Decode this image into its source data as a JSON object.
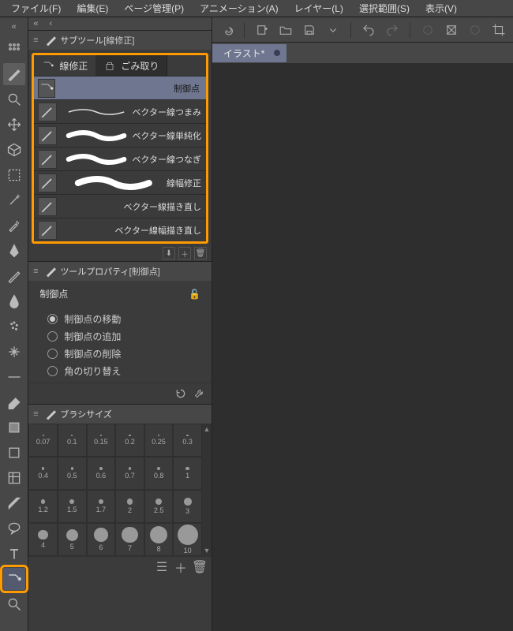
{
  "menu": [
    "ファイル(F)",
    "編集(E)",
    "ページ管理(P)",
    "アニメーション(A)",
    "レイヤー(L)",
    "選択範囲(S)",
    "表示(V)"
  ],
  "doc_tab": "イラスト*",
  "subtool_panel": {
    "title": "サブツール",
    "title_sub": "[線修正]",
    "tabs": [
      {
        "label": "線修正",
        "active": true
      },
      {
        "label": "ごみ取り",
        "active": false
      }
    ],
    "items": [
      {
        "label": "制御点",
        "selected": true,
        "stroke": "none"
      },
      {
        "label": "ベクター線つまみ",
        "stroke": "thin"
      },
      {
        "label": "ベクター線単純化",
        "stroke": "thick"
      },
      {
        "label": "ベクター線つなぎ",
        "stroke": "thick"
      },
      {
        "label": "線幅修正",
        "stroke": "thick"
      },
      {
        "label": "ベクター線描き直し",
        "stroke": "none"
      },
      {
        "label": "ベクター線幅描き直し",
        "stroke": "none"
      }
    ]
  },
  "tool_property": {
    "title": "ツールプロパティ",
    "title_sub": "[制御点]",
    "header": "制御点",
    "options": [
      {
        "label": "制御点の移動",
        "on": true
      },
      {
        "label": "制御点の追加",
        "on": false
      },
      {
        "label": "制御点の削除",
        "on": false
      },
      {
        "label": "角の切り替え",
        "on": false
      }
    ]
  },
  "brush_panel": {
    "title": "ブラシサイズ",
    "sizes": [
      0.07,
      0.1,
      0.15,
      0.2,
      0.25,
      0.3,
      0.4,
      0.5,
      0.6,
      0.7,
      0.8,
      1,
      1.2,
      1.5,
      1.7,
      2,
      2.5,
      3,
      4,
      5,
      6,
      7,
      8,
      10
    ]
  }
}
